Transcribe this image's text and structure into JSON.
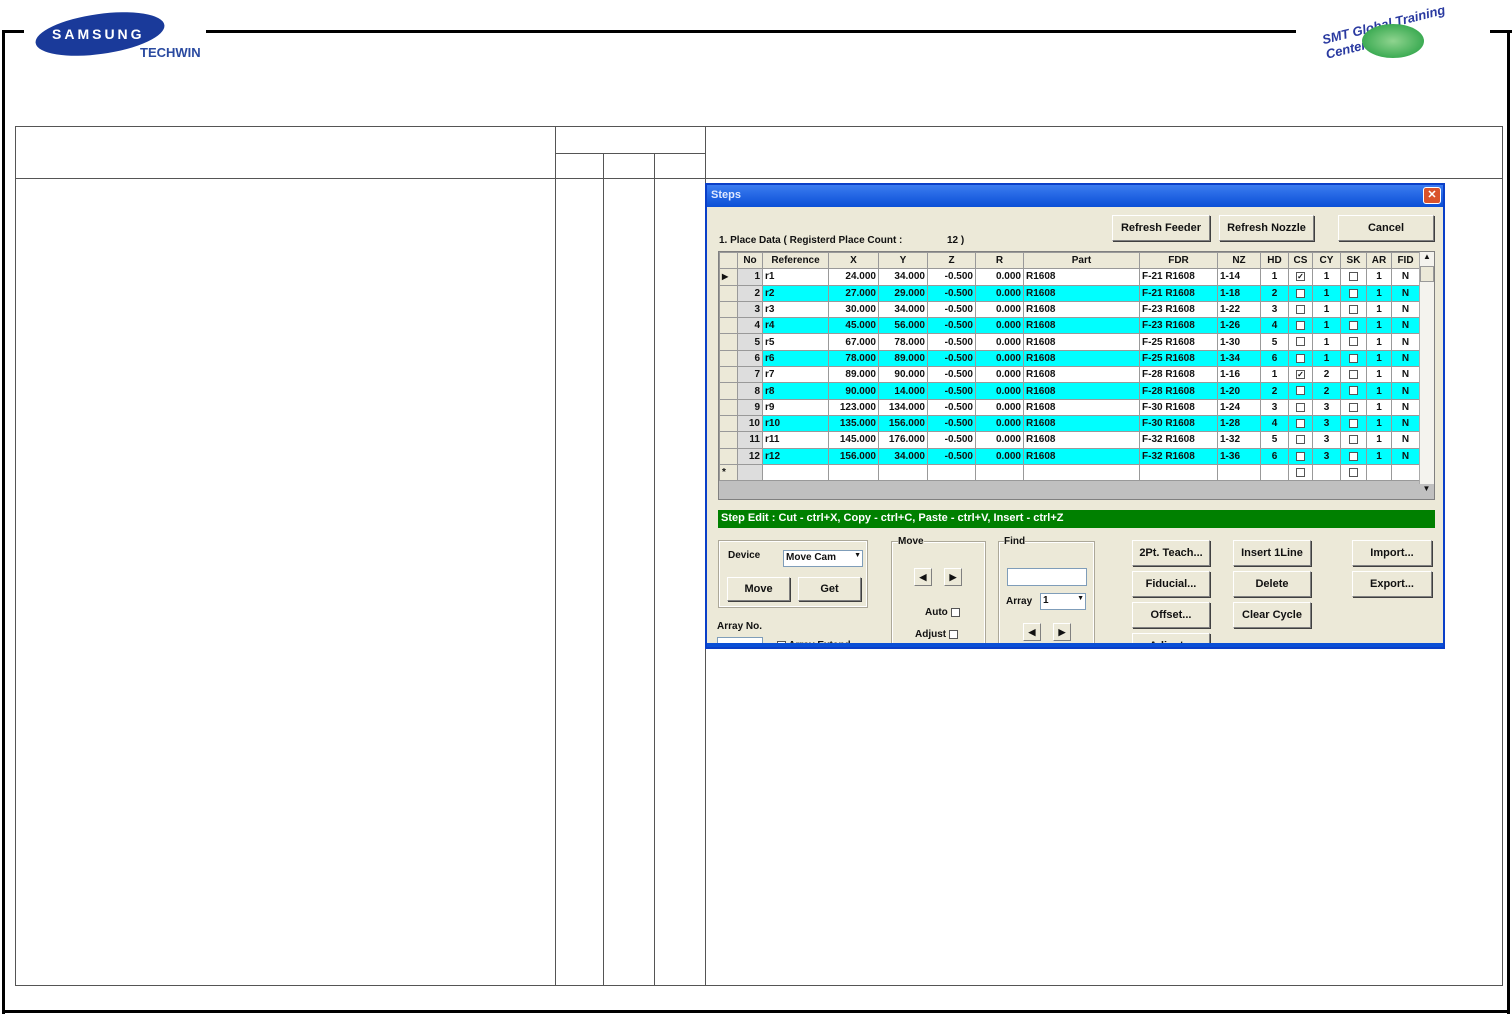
{
  "header": {
    "brand": "SAMSUNG",
    "brand_sub": "TECHWIN",
    "center_logo": "SMT Global Training Center"
  },
  "dialog": {
    "title": "Steps",
    "close_icon": "close-icon",
    "buttons": {
      "refresh_feeder": "Refresh Feeder",
      "refresh_nozzle": "Refresh Nozzle",
      "cancel": "Cancel"
    },
    "place_data_label": "1. Place Data ( Registerd Place Count :",
    "place_count": "12 )",
    "columns": [
      "No",
      "Reference",
      "X",
      "Y",
      "Z",
      "R",
      "Part",
      "FDR",
      "NZ",
      "HD",
      "CS",
      "CY",
      "SK",
      "AR",
      "FID"
    ],
    "rows": [
      [
        "1",
        "r1",
        "24.000",
        "34.000",
        "-0.500",
        "0.000",
        "R1608",
        "F-21 R1608",
        "1-14",
        "1",
        true,
        "1",
        false,
        "1",
        "N"
      ],
      [
        "2",
        "r2",
        "27.000",
        "29.000",
        "-0.500",
        "0.000",
        "R1608",
        "F-21 R1608",
        "1-18",
        "2",
        false,
        "1",
        false,
        "1",
        "N"
      ],
      [
        "3",
        "r3",
        "30.000",
        "34.000",
        "-0.500",
        "0.000",
        "R1608",
        "F-23 R1608",
        "1-22",
        "3",
        false,
        "1",
        false,
        "1",
        "N"
      ],
      [
        "4",
        "r4",
        "45.000",
        "56.000",
        "-0.500",
        "0.000",
        "R1608",
        "F-23 R1608",
        "1-26",
        "4",
        false,
        "1",
        false,
        "1",
        "N"
      ],
      [
        "5",
        "r5",
        "67.000",
        "78.000",
        "-0.500",
        "0.000",
        "R1608",
        "F-25 R1608",
        "1-30",
        "5",
        false,
        "1",
        false,
        "1",
        "N"
      ],
      [
        "6",
        "r6",
        "78.000",
        "89.000",
        "-0.500",
        "0.000",
        "R1608",
        "F-25 R1608",
        "1-34",
        "6",
        false,
        "1",
        false,
        "1",
        "N"
      ],
      [
        "7",
        "r7",
        "89.000",
        "90.000",
        "-0.500",
        "0.000",
        "R1608",
        "F-28 R1608",
        "1-16",
        "1",
        true,
        "2",
        false,
        "1",
        "N"
      ],
      [
        "8",
        "r8",
        "90.000",
        "14.000",
        "-0.500",
        "0.000",
        "R1608",
        "F-28 R1608",
        "1-20",
        "2",
        false,
        "2",
        false,
        "1",
        "N"
      ],
      [
        "9",
        "r9",
        "123.000",
        "134.000",
        "-0.500",
        "0.000",
        "R1608",
        "F-30 R1608",
        "1-24",
        "3",
        false,
        "3",
        false,
        "1",
        "N"
      ],
      [
        "10",
        "r10",
        "135.000",
        "156.000",
        "-0.500",
        "0.000",
        "R1608",
        "F-30 R1608",
        "1-28",
        "4",
        false,
        "3",
        false,
        "1",
        "N"
      ],
      [
        "11",
        "r11",
        "145.000",
        "176.000",
        "-0.500",
        "0.000",
        "R1608",
        "F-32 R1608",
        "1-32",
        "5",
        false,
        "3",
        false,
        "1",
        "N"
      ],
      [
        "12",
        "r12",
        "156.000",
        "34.000",
        "-0.500",
        "0.000",
        "R1608",
        "F-32 R1608",
        "1-36",
        "6",
        false,
        "3",
        false,
        "1",
        "N"
      ]
    ],
    "new_row_marker": "*",
    "current_row_marker": "▶",
    "status_bar": "Step Edit : Cut - ctrl+X,  Copy - ctrl+C,  Paste - ctrl+V,      Insert - ctrl+Z",
    "device": {
      "label": "Device",
      "value": "Move Cam",
      "move": "Move",
      "get": "Get"
    },
    "array_no_label": "Array No.",
    "array_extend_label": "Array Extend",
    "move_group": {
      "label": "Move",
      "auto": "Auto",
      "adjust": "Adjust"
    },
    "find_group": {
      "label": "Find",
      "value": "",
      "array_label": "Array",
      "array_value": "1"
    },
    "actions": {
      "teach": "2Pt. Teach...",
      "fiducial": "Fiducial...",
      "offset": "Offset...",
      "adjust": "Adjust...",
      "insert_line": "Insert 1Line",
      "delete": "Delete",
      "clear_cycle": "Clear Cycle",
      "import": "Import...",
      "export": "Export..."
    },
    "colors": {
      "cyan_row": "#00ffff",
      "status_bar": "#008000",
      "title_bar": "#0a4fd6"
    }
  }
}
